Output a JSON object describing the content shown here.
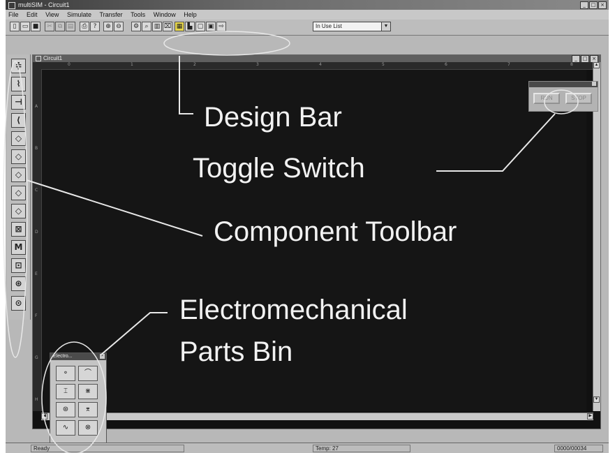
{
  "window": {
    "title": "multiSIM - Circuit1"
  },
  "menu": [
    "File",
    "Edit",
    "View",
    "Simulate",
    "Transfer",
    "Tools",
    "Window",
    "Help"
  ],
  "toolbar": {
    "used_list_label": "In Use List"
  },
  "circuit": {
    "title": "Circuit1",
    "ruler_h": [
      "0",
      "1",
      "2",
      "3",
      "4",
      "5",
      "6",
      "7",
      "8"
    ],
    "ruler_v": [
      "A",
      "B",
      "C",
      "D",
      "E",
      "F",
      "G",
      "H"
    ]
  },
  "toggle": {
    "left": "RUN",
    "right": "STOP"
  },
  "parts_bin": {
    "title": "Electro..."
  },
  "status": {
    "left": "Ready",
    "temp": "Temp: 27",
    "time": "0000/00034"
  },
  "annotations": {
    "design_bar": "Design Bar",
    "toggle_switch": "Toggle Switch",
    "component_toolbar": "Component Toolbar",
    "parts_bin_line1": "Electromechanical",
    "parts_bin_line2": "Parts Bin"
  },
  "colors": {
    "canvas": "#151515",
    "annotation_text": "#f2f2f2",
    "ui_gray": "#b8b8b8"
  }
}
